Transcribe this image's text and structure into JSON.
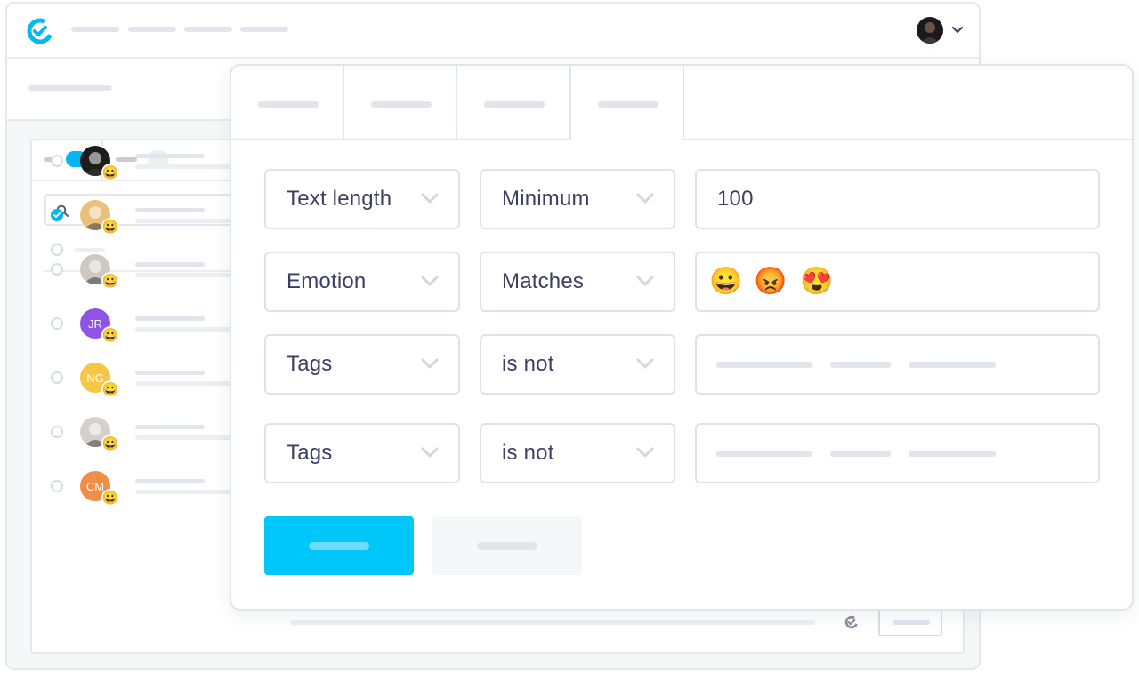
{
  "colors": {
    "accent": "#00c7fa",
    "border": "#dfe2e9",
    "text": "#3c3e64",
    "placeholder": "#e2e5ec"
  },
  "icons": {
    "logo": "app-logo-icon",
    "search": "search-icon",
    "dropdown": "chevron-down-icon",
    "reaction": "😀",
    "small_logo": "app-logo-icon"
  },
  "contacts": [
    {
      "initials": "",
      "color": "#1c1c1c",
      "checked": false
    },
    {
      "initials": "",
      "color": "#e8c27a",
      "checked": true
    },
    {
      "initials": "",
      "color": "#cfc8c0",
      "checked": false
    },
    {
      "initials": "JR",
      "color": "#8f54e6",
      "checked": false
    },
    {
      "initials": "NG",
      "color": "#f7c744",
      "checked": false
    },
    {
      "initials": "",
      "color": "#d6d0cb",
      "checked": false
    },
    {
      "initials": "CM",
      "color": "#f08e48",
      "checked": false
    }
  ],
  "filters": [
    {
      "field": "Text length",
      "operator": "Minimum",
      "value": "100"
    },
    {
      "field": "Emotion",
      "operator": "Matches",
      "emojis": [
        "😀",
        "😡",
        "😍"
      ]
    },
    {
      "field": "Tags",
      "operator": "is not"
    },
    {
      "field": "Tags",
      "operator": "is not"
    }
  ]
}
